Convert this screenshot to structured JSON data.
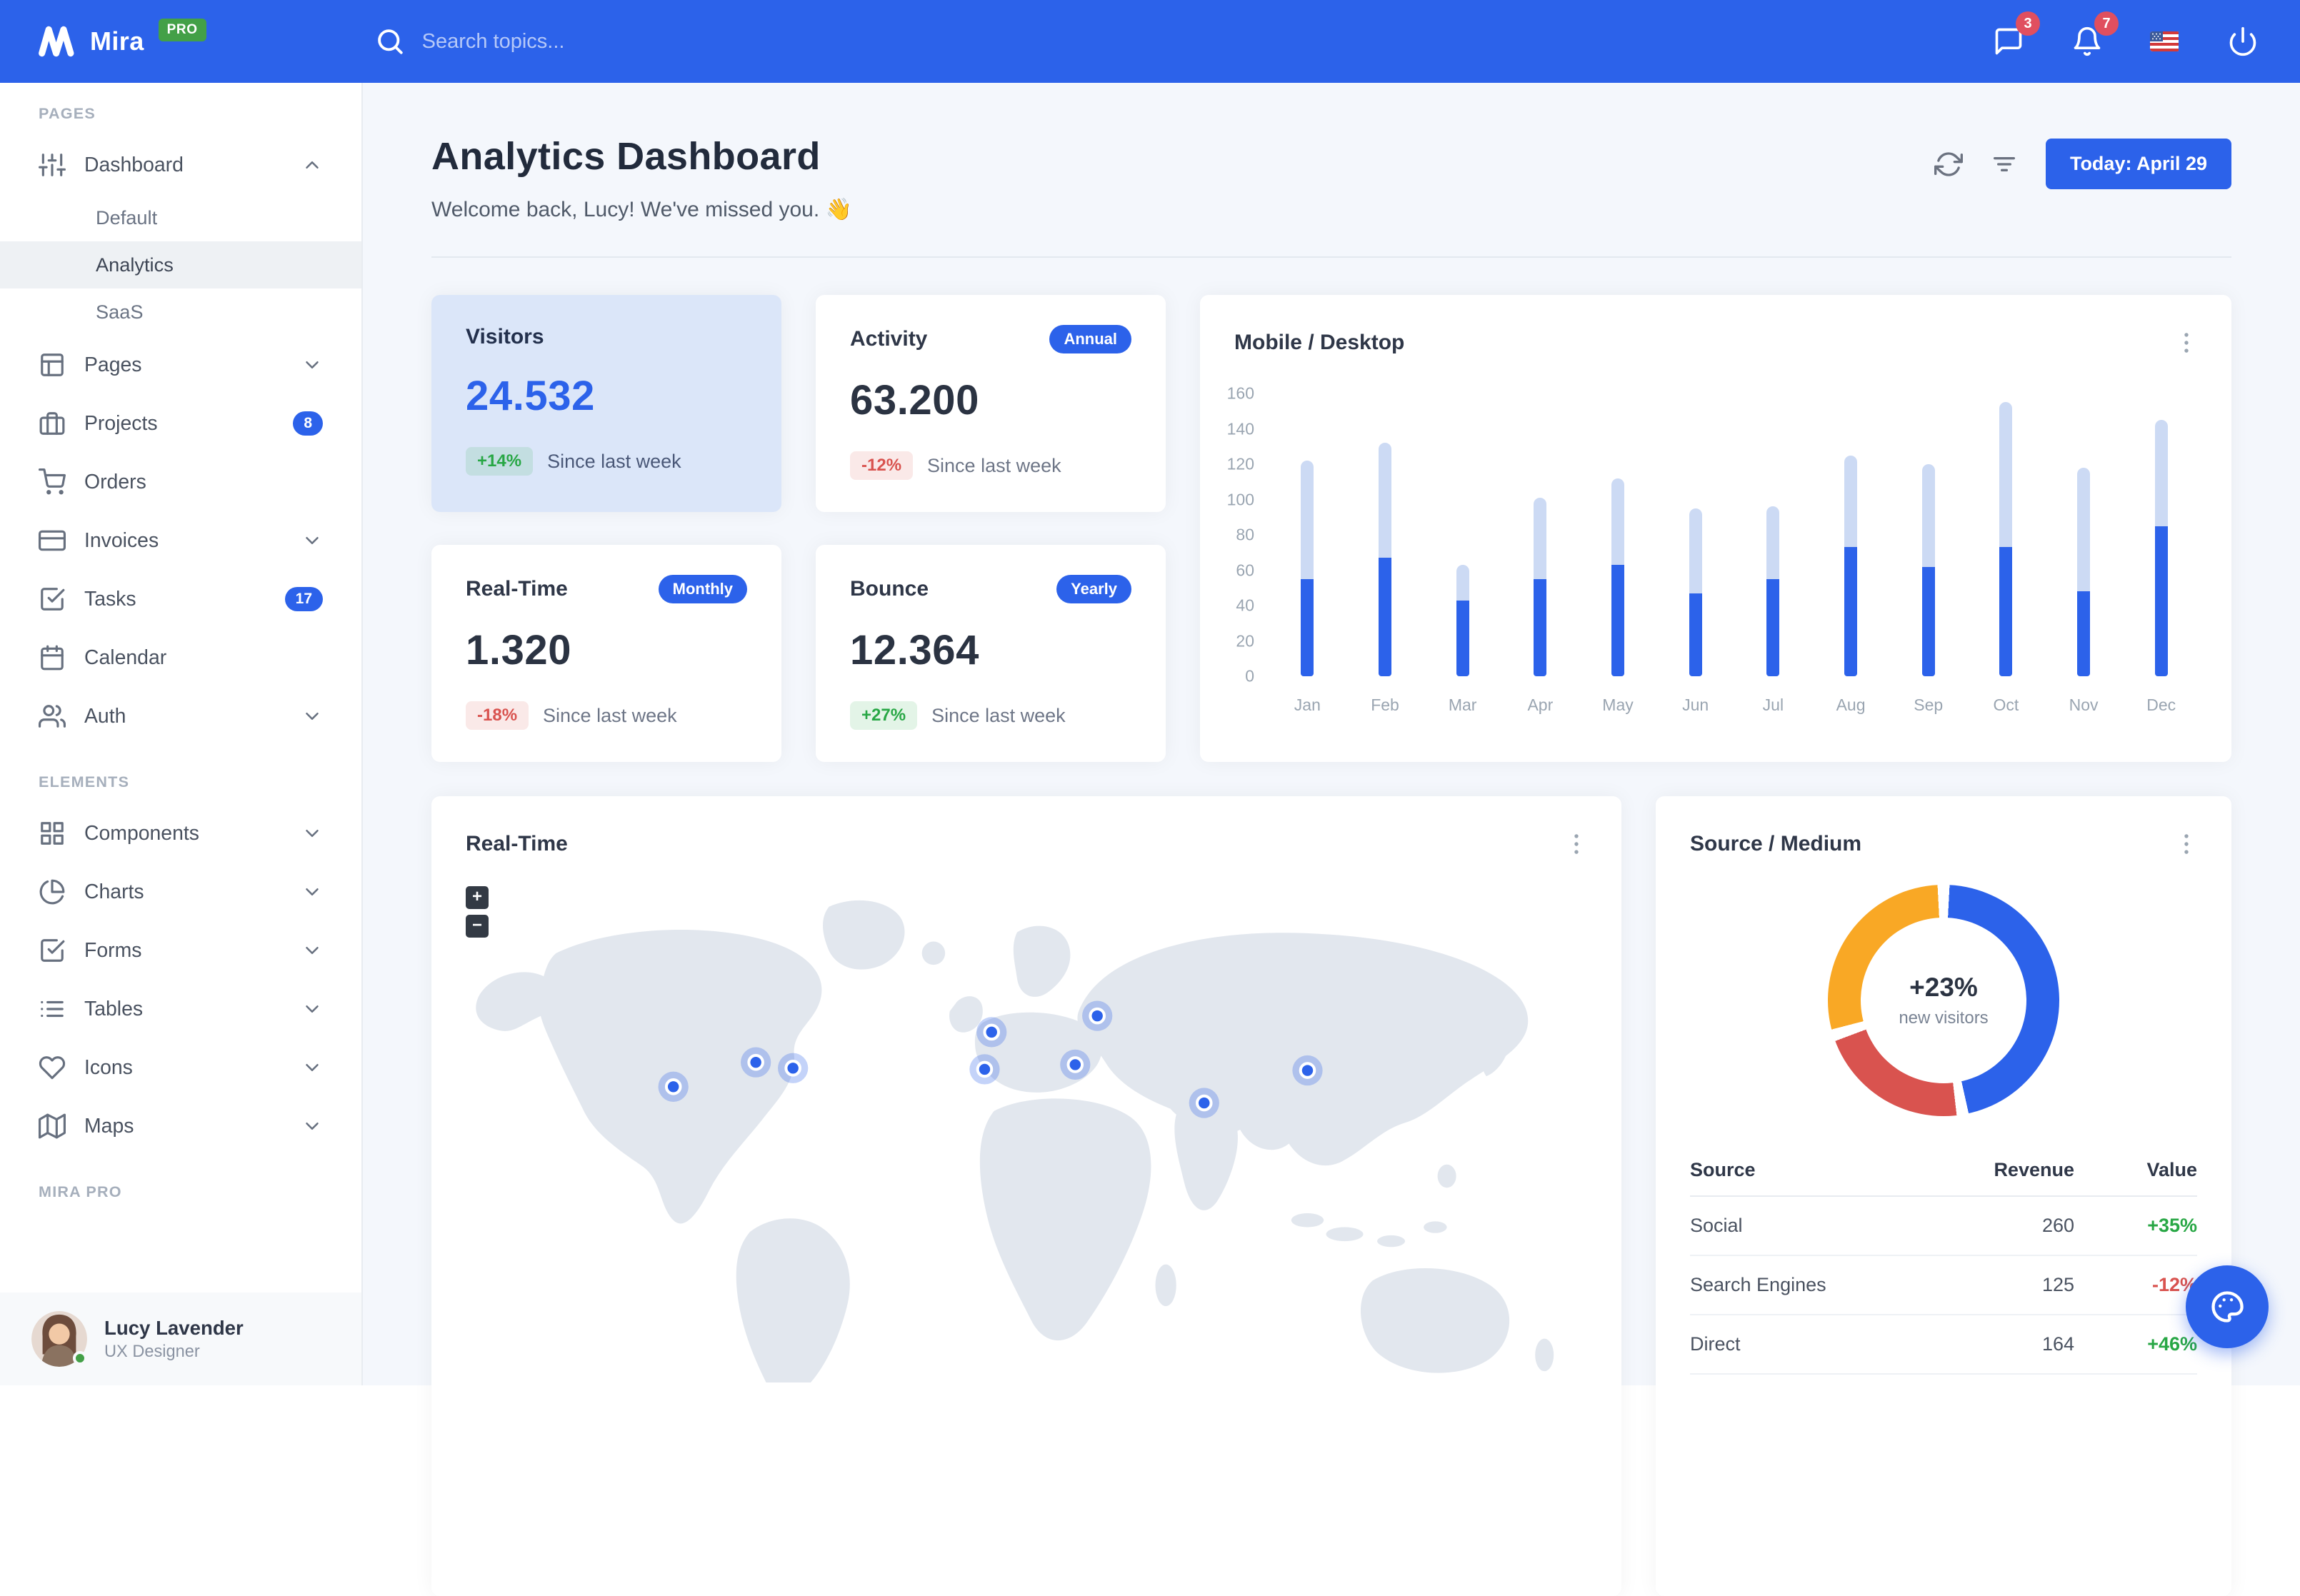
{
  "colors": {
    "primary": "#2c62ea",
    "primary_light": "#ccdaf4",
    "success": "#28a745",
    "danger": "#d9534f",
    "warning": "#f9a825",
    "pro_badge": "#43a047",
    "nav_badge": "#e04f5f"
  },
  "navbar": {
    "brand": "Mira",
    "brand_badge": "PRO",
    "search_placeholder": "Search topics...",
    "messages_badge": "3",
    "alerts_badge": "7",
    "icons": [
      "search-icon",
      "message-square-icon",
      "bell-icon",
      "us-flag-icon",
      "power-icon"
    ]
  },
  "sidebar": {
    "sections": [
      {
        "label": "Pages",
        "items": [
          {
            "label": "Dashboard",
            "icon": "sliders-icon",
            "state": "expanded",
            "children": [
              {
                "label": "Default"
              },
              {
                "label": "Analytics",
                "active": true
              },
              {
                "label": "SaaS"
              }
            ]
          },
          {
            "label": "Pages",
            "icon": "layout-icon",
            "chevron": true
          },
          {
            "label": "Projects",
            "icon": "briefcase-icon",
            "badge": "8"
          },
          {
            "label": "Orders",
            "icon": "shopping-cart-icon"
          },
          {
            "label": "Invoices",
            "icon": "credit-card-icon",
            "chevron": true
          },
          {
            "label": "Tasks",
            "icon": "check-square-icon",
            "badge": "17"
          },
          {
            "label": "Calendar",
            "icon": "calendar-icon"
          },
          {
            "label": "Auth",
            "icon": "users-icon",
            "chevron": true
          }
        ]
      },
      {
        "label": "Elements",
        "items": [
          {
            "label": "Components",
            "icon": "grid-icon",
            "chevron": true
          },
          {
            "label": "Charts",
            "icon": "pie-chart-icon",
            "chevron": true
          },
          {
            "label": "Forms",
            "icon": "check-square-icon",
            "chevron": true
          },
          {
            "label": "Tables",
            "icon": "list-icon",
            "chevron": true
          },
          {
            "label": "Icons",
            "icon": "heart-icon",
            "chevron": true
          },
          {
            "label": "Maps",
            "icon": "map-icon",
            "chevron": true
          }
        ]
      },
      {
        "label": "Mira Pro",
        "items": []
      }
    ],
    "user": {
      "name": "Lucy Lavender",
      "role": "UX Designer",
      "status": "online"
    }
  },
  "header": {
    "title": "Analytics Dashboard",
    "subtitle": "Welcome back, Lucy! We've missed you. 👋",
    "date_button": "Today: April 29",
    "icons": [
      "refresh-icon",
      "filter-icon"
    ]
  },
  "stats": {
    "visitors": {
      "title": "Visitors",
      "value": "24.532",
      "change": "+14%",
      "trend": "up",
      "note": "Since last week",
      "highlighted": true
    },
    "activity": {
      "title": "Activity",
      "badge": "Annual",
      "value": "63.200",
      "change": "-12%",
      "trend": "down",
      "note": "Since last week"
    },
    "realtime": {
      "title": "Real-Time",
      "badge": "Monthly",
      "value": "1.320",
      "change": "-18%",
      "trend": "down",
      "note": "Since last week"
    },
    "bounce": {
      "title": "Bounce",
      "badge": "Yearly",
      "value": "12.364",
      "change": "+27%",
      "trend": "up",
      "note": "Since last week"
    }
  },
  "chart_data": [
    {
      "type": "bar",
      "stacked": true,
      "title": "Mobile / Desktop",
      "categories": [
        "Jan",
        "Feb",
        "Mar",
        "Apr",
        "May",
        "Jun",
        "Jul",
        "Aug",
        "Sep",
        "Oct",
        "Nov",
        "Dec"
      ],
      "series": [
        {
          "name": "Mobile",
          "color": "#2c62ea",
          "values": [
            55,
            67,
            43,
            55,
            63,
            47,
            55,
            73,
            62,
            73,
            48,
            85
          ]
        },
        {
          "name": "Desktop",
          "color": "#ccdaf4",
          "values": [
            67,
            65,
            20,
            46,
            49,
            48,
            41,
            52,
            58,
            82,
            70,
            60
          ]
        }
      ],
      "xlabel": "",
      "ylabel": "",
      "ylim": [
        0,
        160
      ],
      "ytick_step": 20,
      "grid": false,
      "legend": "none"
    },
    {
      "type": "pie",
      "donut": true,
      "title": "Source / Medium",
      "labels": [
        "Social",
        "Search Engines",
        "Direct"
      ],
      "values": [
        260,
        125,
        164
      ],
      "colors": [
        "#2c62ea",
        "#d9534f",
        "#f9a825"
      ],
      "center_label": "+23%",
      "center_sublabel": "new visitors",
      "legend": "none"
    }
  ],
  "realtime_map": {
    "title": "Real-Time",
    "zoom_in": "+",
    "zoom_out": "−",
    "markers": [
      {
        "x": 196,
        "y": 185
      },
      {
        "x": 267,
        "y": 164
      },
      {
        "x": 299,
        "y": 169
      },
      {
        "x": 464,
        "y": 170
      },
      {
        "x": 470,
        "y": 138
      },
      {
        "x": 542,
        "y": 166
      },
      {
        "x": 561,
        "y": 124
      },
      {
        "x": 653,
        "y": 199
      },
      {
        "x": 742,
        "y": 171
      }
    ]
  },
  "source_medium": {
    "title": "Source / Medium",
    "table": {
      "headers": [
        "Source",
        "Revenue",
        "Value"
      ],
      "rows": [
        {
          "source": "Social",
          "revenue": "260",
          "value": "+35%",
          "trend": "up"
        },
        {
          "source": "Search Engines",
          "revenue": "125",
          "value": "-12%",
          "trend": "down"
        },
        {
          "source": "Direct",
          "revenue": "164",
          "value": "+46%",
          "trend": "up"
        }
      ]
    }
  },
  "fab": {
    "icon": "palette-icon"
  }
}
